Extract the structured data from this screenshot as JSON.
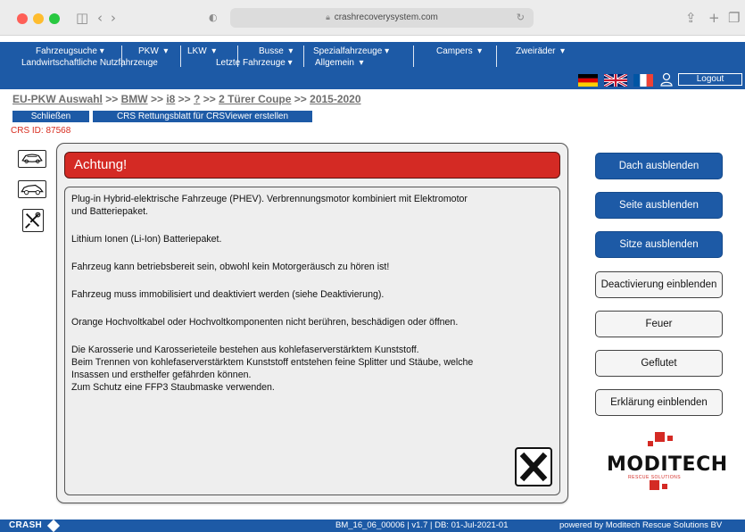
{
  "browser": {
    "url": "crashrecoverysystem.com"
  },
  "nav": {
    "row1": [
      "Fahrzeugsuche",
      "PKW",
      "LKW",
      "Busse",
      "Spezialfahrzeuge",
      "Campers",
      "Zweiräder"
    ],
    "row2": [
      "Landwirtschaftliche Nutzfahrzeuge",
      "Letzte Fahrzeuge",
      "Allgemein"
    ],
    "dropdown_glyph": "▾",
    "logout_label": "Logout"
  },
  "breadcrumb": {
    "root": "EU-PKW Auswahl",
    "sep": ">>",
    "brand": "BMW",
    "model": "i8",
    "variant": "?",
    "body": "2 Türer Coupe",
    "years": "2015-2020"
  },
  "actions": {
    "close_label": "Schließen",
    "create_label": "CRS Rettungsblatt für CRSViewer erstellen"
  },
  "crs_id_label": "CRS ID: 87568",
  "alert": {
    "title": "Achtung!",
    "paragraphs": [
      "Plug-in Hybrid-elektrische Fahrzeuge (PHEV). Verbrennungsmotor kombiniert mit Elektromotor\nund Batteriepaket.",
      "Lithium Ionen (Li-Ion) Batteriepaket.",
      "Fahrzeug kann betriebsbereit sein, obwohl kein Motorgeräusch zu hören ist!",
      "Fahrzeug muss immobilisiert und deaktiviert werden (siehe Deaktivierung).",
      "Orange Hochvoltkabel oder Hochvoltkomponenten nicht berühren, beschädigen oder öffnen.",
      "Die Karosserie und Karosserieteile bestehen aus kohlefaserverstärktem Kunststoff.\nBeim Trennen von kohlefaserverstärktem Kunststoff entstehen feine Splitter und Stäube, welche\nInsassen und ersthelfer gefährden können.\nZum Schutz eine FFP3 Staubmaske verwenden."
    ]
  },
  "right_buttons": [
    "Dach ausblenden",
    "Seite ausblenden",
    "Sitze ausblenden",
    "Deactivierung einblenden",
    "Feuer",
    "Geflutet",
    "Erklärung einblenden"
  ],
  "logo": {
    "text": "MODITECH",
    "sub": "RESCUE SOLUTIONS"
  },
  "footer": {
    "brand": "CRASH",
    "version": "BM_16_06_00006 | v1.7 | DB: 01-Jul-2021-01",
    "powered": "powered by Moditech Rescue Solutions BV"
  },
  "colors": {
    "nav_blue": "#1d5aa6",
    "alert_red": "#d42a24",
    "crs_red": "#d82c1e"
  }
}
